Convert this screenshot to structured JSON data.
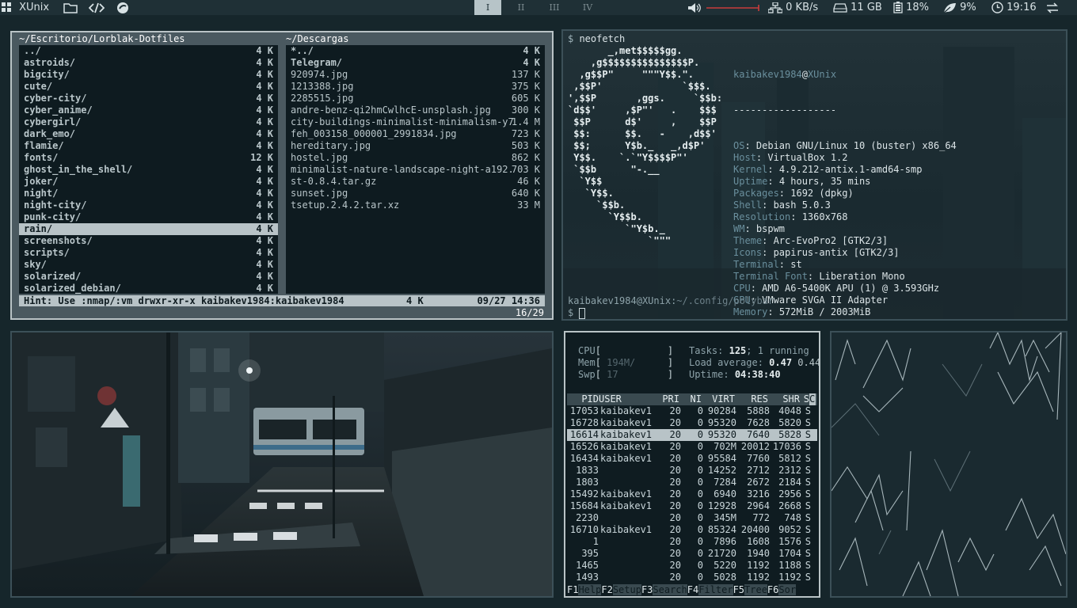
{
  "topbar": {
    "distro": "XUnix",
    "workspaces": [
      {
        "label": "I",
        "active": true
      },
      {
        "label": "II",
        "active": false
      },
      {
        "label": "III",
        "active": false
      },
      {
        "label": "IV",
        "active": false
      }
    ],
    "volume_percent": 100,
    "net_speed": "0 KB/s",
    "disk": "11 GB",
    "battery": "18%",
    "cpu": "9%",
    "clock": "19:16",
    "accent": "#c83c3c"
  },
  "file_manager": {
    "left_path": "~/Escritorio/Lorblak-Dotfiles",
    "right_path": "~/Descargas",
    "left_entries": [
      {
        "name": "../",
        "size": "4 K",
        "dir": true
      },
      {
        "name": "astroids/",
        "size": "4 K",
        "dir": true
      },
      {
        "name": "bigcity/",
        "size": "4 K",
        "dir": true
      },
      {
        "name": "cute/",
        "size": "4 K",
        "dir": true
      },
      {
        "name": "cyber-city/",
        "size": "4 K",
        "dir": true
      },
      {
        "name": "cyber_anime/",
        "size": "4 K",
        "dir": true
      },
      {
        "name": "cybergirl/",
        "size": "4 K",
        "dir": true
      },
      {
        "name": "dark_emo/",
        "size": "4 K",
        "dir": true
      },
      {
        "name": "flamie/",
        "size": "4 K",
        "dir": true
      },
      {
        "name": "fonts/",
        "size": "12 K",
        "dir": true
      },
      {
        "name": "ghost_in_the_shell/",
        "size": "4 K",
        "dir": true
      },
      {
        "name": "joker/",
        "size": "4 K",
        "dir": true
      },
      {
        "name": "night/",
        "size": "4 K",
        "dir": true
      },
      {
        "name": "night-city/",
        "size": "4 K",
        "dir": true
      },
      {
        "name": "punk-city/",
        "size": "4 K",
        "dir": true
      },
      {
        "name": "rain/",
        "size": "4 K",
        "dir": true,
        "selected": true
      },
      {
        "name": "screenshots/",
        "size": "4 K",
        "dir": true
      },
      {
        "name": "scripts/",
        "size": "4 K",
        "dir": true
      },
      {
        "name": "sky/",
        "size": "4 K",
        "dir": true
      },
      {
        "name": "solarized/",
        "size": "4 K",
        "dir": true
      },
      {
        "name": "solarized_debian/",
        "size": "4 K",
        "dir": true
      }
    ],
    "right_entries": [
      {
        "name": "*../",
        "size": "4 K",
        "dir": true
      },
      {
        "name": "Telegram/",
        "size": "4 K",
        "dir": true
      },
      {
        "name": "920974.jpg",
        "size": "137 K",
        "dir": false
      },
      {
        "name": "1213388.jpg",
        "size": "375 K",
        "dir": false
      },
      {
        "name": "2285515.jpg",
        "size": "605 K",
        "dir": false
      },
      {
        "name": "andre-benz-qi2hmCwlhcE-unsplash.jpg",
        "size": "300 K",
        "dir": false
      },
      {
        "name": "city-buildings-minimalist-minimalism-y7",
        "size": "1.4 M",
        "dir": false
      },
      {
        "name": "feh_003158_000001_2991834.jpg",
        "size": "723 K",
        "dir": false
      },
      {
        "name": "hereditary.jpg",
        "size": "503 K",
        "dir": false
      },
      {
        "name": "hostel.jpg",
        "size": "862 K",
        "dir": false
      },
      {
        "name": "minimalist-nature-landscape-night-a192.",
        "size": "703 K",
        "dir": false
      },
      {
        "name": "st-0.8.4.tar.gz",
        "size": "46 K",
        "dir": false
      },
      {
        "name": "sunset.jpg",
        "size": "640 K",
        "dir": false
      },
      {
        "name": "tsetup.2.4.2.tar.xz",
        "size": "33 M",
        "dir": false
      }
    ],
    "status_hint": "Hint: Use :nmap/:vm drwxr-xr-x kaibakev1984:kaibakev1984",
    "status_size": "4 K",
    "status_date": "09/27 14:36",
    "position": "16/29"
  },
  "neofetch": {
    "command": "neofetch",
    "user": "kaibakev1984",
    "host": "XUnix",
    "separator": "------------------",
    "ascii": "       _,met$$$$$gg.\n    ,g$$$$$$$$$$$$$$$P.\n  ,g$$P\"     \"\"\"Y$$.\".\n ,$$P'              `$$$.\n',$$P       ,ggs.     `$$b:\n`d$$'     ,$P\"'   .    $$$\n $$P      d$'     ,    $$P\n $$:      $$.   -    ,d$$'\n $$;      Y$b._   _,d$P'\n Y$$.    `.`\"Y$$$$P\"'\n `$$b      \"-.__\n  `Y$$\n   `Y$$.\n     `$$b.\n       `Y$$b.\n          `\"Y$b._\n              `\"\"\"",
    "info": [
      {
        "key": "OS",
        "value": "Debian GNU/Linux 10 (buster) x86_64"
      },
      {
        "key": "Host",
        "value": "VirtualBox 1.2"
      },
      {
        "key": "Kernel",
        "value": "4.9.212-antix.1-amd64-smp"
      },
      {
        "key": "Uptime",
        "value": "4 hours, 35 mins"
      },
      {
        "key": "Packages",
        "value": "1692 (dpkg)"
      },
      {
        "key": "Shell",
        "value": "bash 5.0.3"
      },
      {
        "key": "Resolution",
        "value": "1360x768"
      },
      {
        "key": "WM",
        "value": "bspwm"
      },
      {
        "key": "Theme",
        "value": "Arc-EvoPro2 [GTK2/3]"
      },
      {
        "key": "Icons",
        "value": "papirus-antix [GTK2/3]"
      },
      {
        "key": "Terminal",
        "value": "st"
      },
      {
        "key": "Terminal Font",
        "value": "Liberation Mono"
      },
      {
        "key": "CPU",
        "value": "AMD A6-5400K APU (1) @ 3.593GHz"
      },
      {
        "key": "GPU",
        "value": "VMware SVGA II Adapter"
      },
      {
        "key": "Memory",
        "value": "572MiB / 2003MiB"
      }
    ],
    "palette": [
      "#2c4452",
      "#3e5e6e",
      "#4a6472",
      "#5a6c76",
      "#6b7880",
      "#7e8a92",
      "#9aa6ad",
      "#cdd4d7"
    ],
    "prompt_user": "kaibakev1984",
    "prompt_host": "XUnix",
    "prompt_path": "~/.config/polybar"
  },
  "htop": {
    "cpu_label": "CPU",
    "mem_label": "Mem",
    "mem_value": "194M/",
    "swp_label": "Swp",
    "swp_value": "17",
    "tasks_label": "Tasks:",
    "tasks": "125",
    "running": "1 running",
    "load_label": "Load average:",
    "load1": "0.47",
    "load5": "0.44",
    "uptime_label": "Uptime:",
    "uptime": "04:38:40",
    "headers": [
      "PID",
      "USER",
      "PRI",
      "NI",
      "VIRT",
      "RES",
      "SHR",
      "S",
      "C"
    ],
    "processes": [
      {
        "pid": "17053",
        "user": "kaibakev1",
        "pri": "20",
        "ni": "0",
        "virt": "90284",
        "res": "5888",
        "shr": "4048",
        "s": "S"
      },
      {
        "pid": "16728",
        "user": "kaibakev1",
        "pri": "20",
        "ni": "0",
        "virt": "95320",
        "res": "7628",
        "shr": "5820",
        "s": "S"
      },
      {
        "pid": "16614",
        "user": "kaibakev1",
        "pri": "20",
        "ni": "0",
        "virt": "95320",
        "res": "7640",
        "shr": "5828",
        "s": "S",
        "selected": true
      },
      {
        "pid": "16526",
        "user": "kaibakev1",
        "pri": "20",
        "ni": "0",
        "virt": "702M",
        "res": "20012",
        "shr": "17036",
        "s": "S"
      },
      {
        "pid": "16434",
        "user": "kaibakev1",
        "pri": "20",
        "ni": "0",
        "virt": "95584",
        "res": "7760",
        "shr": "5812",
        "s": "S"
      },
      {
        "pid": "1833",
        "user": "",
        "pri": "20",
        "ni": "0",
        "virt": "14252",
        "res": "2712",
        "shr": "2312",
        "s": "S"
      },
      {
        "pid": "1803",
        "user": "",
        "pri": "20",
        "ni": "0",
        "virt": "7284",
        "res": "2672",
        "shr": "2184",
        "s": "S"
      },
      {
        "pid": "15492",
        "user": "kaibakev1",
        "pri": "20",
        "ni": "0",
        "virt": "6940",
        "res": "3216",
        "shr": "2956",
        "s": "S"
      },
      {
        "pid": "15684",
        "user": "kaibakev1",
        "pri": "20",
        "ni": "0",
        "virt": "12928",
        "res": "2964",
        "shr": "2668",
        "s": "S"
      },
      {
        "pid": "2230",
        "user": "",
        "pri": "20",
        "ni": "0",
        "virt": "345M",
        "res": "772",
        "shr": "748",
        "s": "S"
      },
      {
        "pid": "16710",
        "user": "kaibakev1",
        "pri": "20",
        "ni": "0",
        "virt": "85324",
        "res": "20400",
        "shr": "9052",
        "s": "S"
      },
      {
        "pid": "1",
        "user": "",
        "pri": "20",
        "ni": "0",
        "virt": "7896",
        "res": "1608",
        "shr": "1576",
        "s": "S"
      },
      {
        "pid": "395",
        "user": "",
        "pri": "20",
        "ni": "0",
        "virt": "21720",
        "res": "1940",
        "shr": "1704",
        "s": "S"
      },
      {
        "pid": "1465",
        "user": "",
        "pri": "20",
        "ni": "0",
        "virt": "5220",
        "res": "1192",
        "shr": "1188",
        "s": "S"
      },
      {
        "pid": "1493",
        "user": "",
        "pri": "20",
        "ni": "0",
        "virt": "5028",
        "res": "1192",
        "shr": "1192",
        "s": "S"
      }
    ],
    "fkeys": [
      {
        "key": "F1",
        "label": "Help"
      },
      {
        "key": "F2",
        "label": "Setup"
      },
      {
        "key": "F3",
        "label": "Search"
      },
      {
        "key": "F4",
        "label": "Filter"
      },
      {
        "key": "F5",
        "label": "Tree"
      },
      {
        "key": "F6",
        "label": "Sor"
      }
    ]
  }
}
